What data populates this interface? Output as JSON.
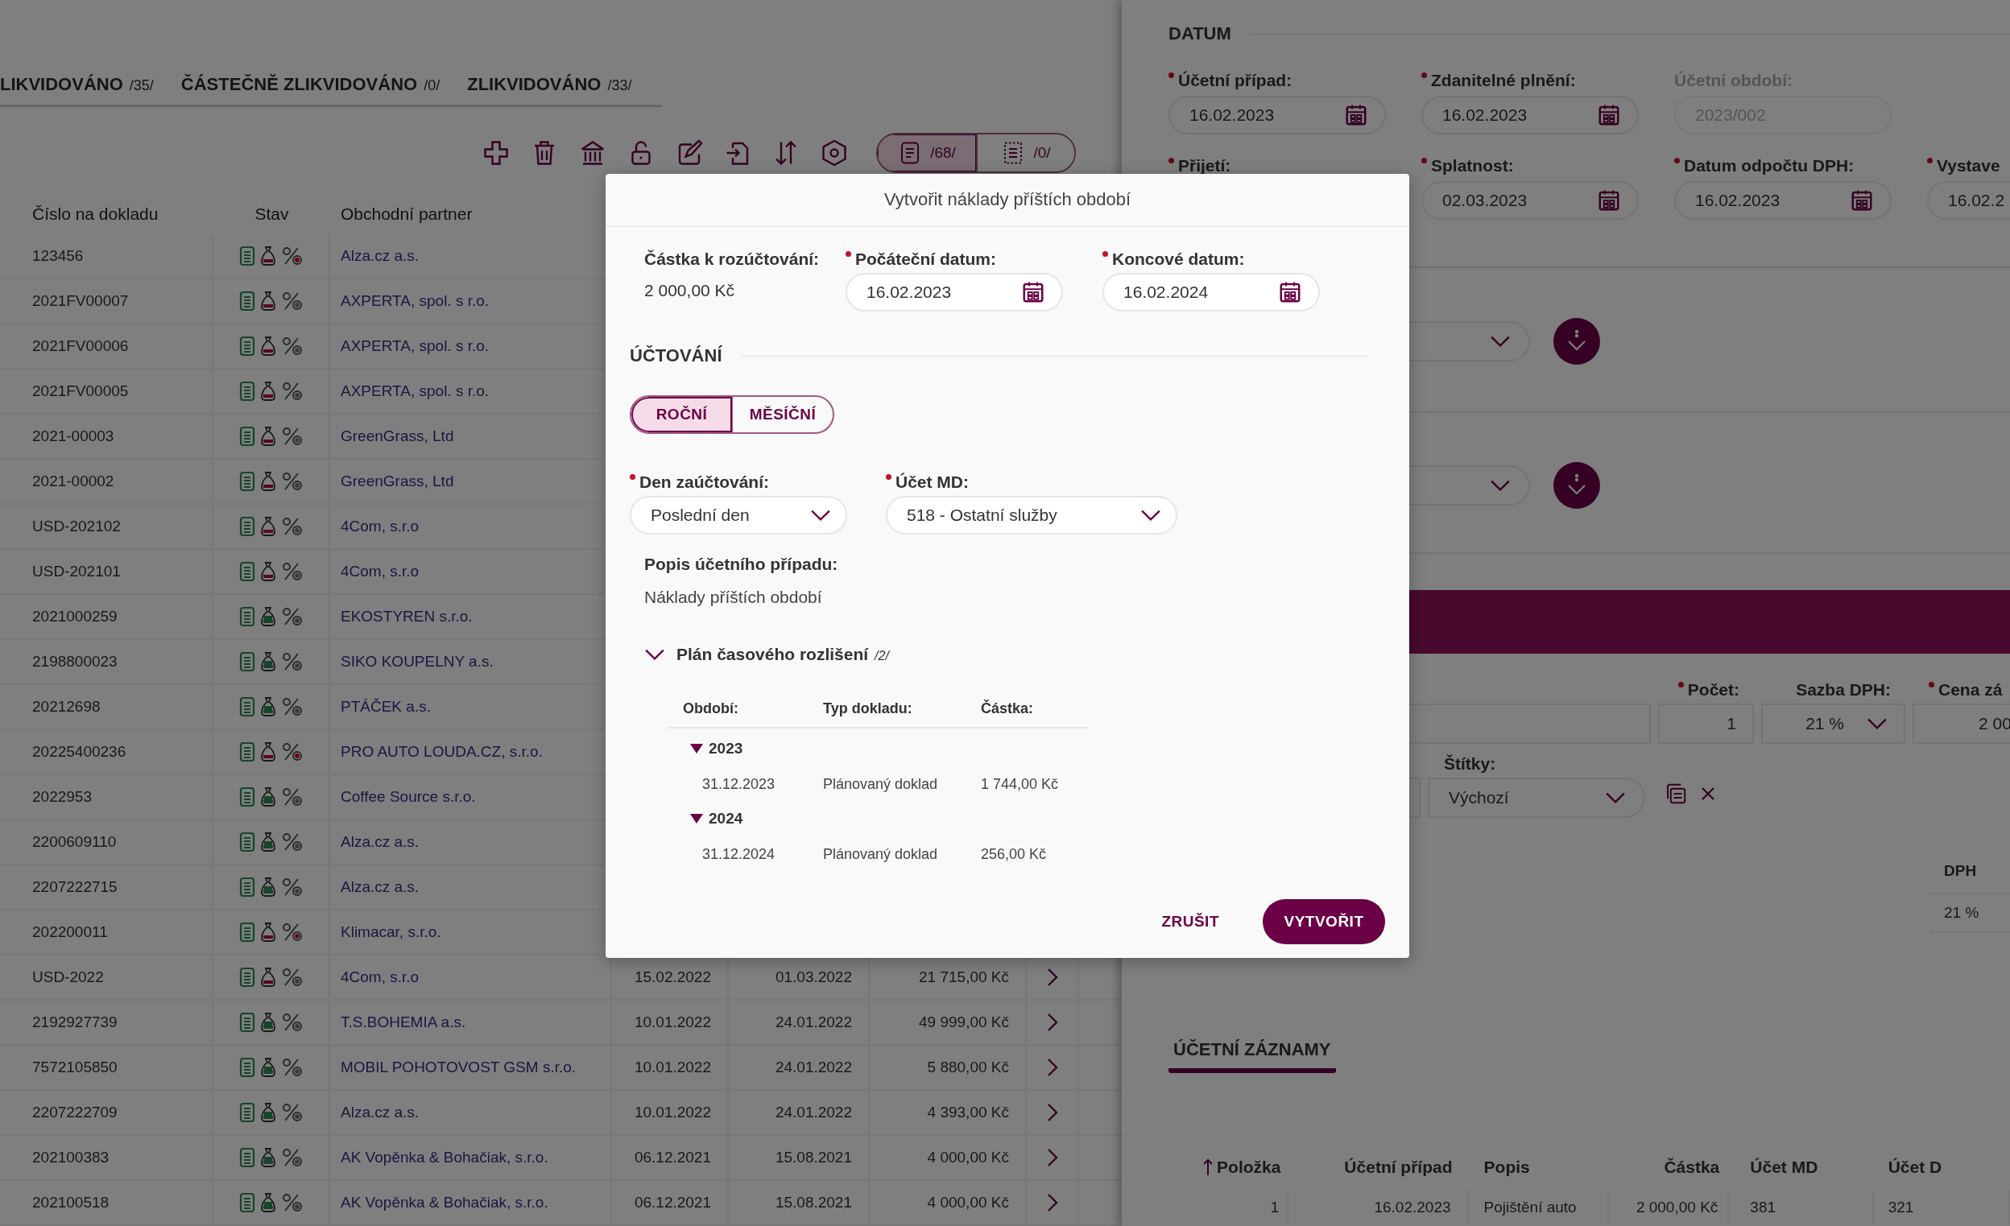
{
  "tabs": [
    {
      "label": "LIKVIDOVÁNO",
      "count": "/35/"
    },
    {
      "label": "ČÁSTEČNĚ ZLIKVIDOVÁNO",
      "count": "/0/"
    },
    {
      "label": "ZLIKVIDOVÁNO",
      "count": "/33/"
    }
  ],
  "view_toggle": [
    {
      "kind": "documents",
      "count": "/68/",
      "selected": true
    },
    {
      "kind": "drafts",
      "count": "/0/",
      "selected": false
    }
  ],
  "table": {
    "columns": [
      "Číslo na dokladu",
      "Stav",
      "Obchodní partner"
    ],
    "rows": [
      {
        "number": "123456",
        "settled": false,
        "vat_alert": true,
        "partner": "Alza.cz a.s."
      },
      {
        "number": "2021FV00007",
        "settled": false,
        "vat_alert": false,
        "partner": "AXPERTA, spol. s r.o."
      },
      {
        "number": "2021FV00006",
        "settled": false,
        "vat_alert": false,
        "partner": "AXPERTA, spol. s r.o."
      },
      {
        "number": "2021FV00005",
        "settled": false,
        "vat_alert": false,
        "partner": "AXPERTA, spol. s r.o."
      },
      {
        "number": "2021-00003",
        "settled": false,
        "vat_alert": false,
        "partner": "GreenGrass, Ltd"
      },
      {
        "number": "2021-00002",
        "settled": false,
        "vat_alert": false,
        "partner": "GreenGrass, Ltd"
      },
      {
        "number": "USD-202102",
        "settled": false,
        "vat_alert": false,
        "partner": "4Com, s.r.o"
      },
      {
        "number": "USD-202101",
        "settled": false,
        "vat_alert": false,
        "partner": "4Com, s.r.o"
      },
      {
        "number": "2021000259",
        "settled": true,
        "vat_alert": false,
        "partner": "EKOSTYREN s.r.o."
      },
      {
        "number": "2198800023",
        "settled": true,
        "vat_alert": false,
        "partner": "SIKO KOUPELNY a.s."
      },
      {
        "number": "20212698",
        "settled": true,
        "vat_alert": false,
        "partner": "PTÁČEK a.s."
      },
      {
        "number": "20225400236",
        "settled": false,
        "vat_alert": true,
        "partner": "PRO AUTO LOUDA.CZ, s.r.o."
      },
      {
        "number": "2022953",
        "settled": true,
        "vat_alert": false,
        "partner": "Coffee Source s.r.o."
      },
      {
        "number": "2200609110",
        "settled": true,
        "vat_alert": false,
        "partner": "Alza.cz a.s."
      },
      {
        "number": "2207222715",
        "settled": true,
        "vat_alert": false,
        "partner": "Alza.cz a.s."
      },
      {
        "number": "202200011",
        "settled": false,
        "vat_alert": true,
        "partner": "Klimacar, s.r.o."
      },
      {
        "number": "USD-2022",
        "settled": false,
        "vat_alert": false,
        "partner": "4Com, s.r.o",
        "issued": "15.02.2022",
        "due": "01.03.2022",
        "amount": "21 715,00 Kč"
      },
      {
        "number": "2192927739",
        "settled": true,
        "vat_alert": false,
        "partner": "T.S.BOHEMIA a.s.",
        "issued": "10.01.2022",
        "due": "24.01.2022",
        "amount": "49 999,00 Kč"
      },
      {
        "number": "7572105850",
        "settled": true,
        "vat_alert": false,
        "partner": "MOBIL POHOTOVOST GSM s.r.o.",
        "issued": "10.01.2022",
        "due": "24.01.2022",
        "amount": "5 880,00 Kč"
      },
      {
        "number": "2207222709",
        "settled": true,
        "vat_alert": false,
        "partner": "Alza.cz a.s.",
        "issued": "10.01.2022",
        "due": "24.01.2022",
        "amount": "4 393,00 Kč"
      },
      {
        "number": "202100383",
        "settled": true,
        "vat_alert": false,
        "partner": "AK Vopěnka & Bohačiak, s.r.o.",
        "issued": "06.12.2021",
        "due": "15.08.2021",
        "amount": "4 000,00 Kč"
      },
      {
        "number": "202100518",
        "settled": true,
        "vat_alert": false,
        "partner": "AK Vopěnka & Bohačiak, s.r.o.",
        "issued": "06.12.2021",
        "due": "15.08.2021",
        "amount": "4 000,00 Kč"
      }
    ]
  },
  "detail": {
    "date_section": "DATUM",
    "date_fields": [
      {
        "label": "Účetní případ:",
        "required": true,
        "disabled": false,
        "value": "16.02.2023"
      },
      {
        "label": "Zdanitelné plnění:",
        "required": true,
        "disabled": false,
        "value": "16.02.2023"
      },
      {
        "label": "Účetní období:",
        "required": false,
        "disabled": true,
        "value": "2023/002"
      },
      {
        "label": "Přijetí:",
        "required": true,
        "disabled": false
      },
      {
        "label": "Splatnost:",
        "required": true,
        "disabled": false,
        "value": "02.03.2023"
      },
      {
        "label": "Datum odpočtu DPH:",
        "required": true,
        "disabled": false,
        "value": "16.02.2023"
      },
      {
        "label": "Vystave",
        "required": true,
        "disabled": false,
        "value": "16.02.2"
      }
    ],
    "item_fields": [
      {
        "label": "Počet:",
        "required": true,
        "kind": "input",
        "value": "1"
      },
      {
        "label": "Sazba DPH:",
        "required": false,
        "kind": "select",
        "value": "21 %"
      },
      {
        "label": "Cena zá",
        "required": true,
        "kind": "input",
        "value": "2 00"
      }
    ],
    "tags": {
      "label": "Štítky:",
      "value": "Výchozí"
    },
    "vat_column": {
      "header": "DPH",
      "value": "21 %"
    },
    "records": {
      "tab": "ÚČETNÍ ZÁZNAMY",
      "columns": [
        {
          "label": "Položka",
          "sorted": true
        },
        {
          "label": "Účetní případ",
          "sorted": false
        },
        {
          "label": "Popis",
          "sorted": false
        },
        {
          "label": "Částka",
          "sorted": false
        },
        {
          "label": "Účet MD",
          "sorted": false
        },
        {
          "label": "Účet D",
          "sorted": false
        }
      ],
      "rows": [
        [
          "1",
          "16.02.2023",
          "Pojištění auto",
          "2 000,00 Kč",
          "381",
          "321"
        ]
      ]
    }
  },
  "dialog": {
    "title": "Vytvořit náklady příštích období",
    "amount": {
      "label": "Částka k rozúčtování:",
      "value": "2 000,00 Kč"
    },
    "dates": [
      {
        "label": "Počáteční datum:",
        "required": true,
        "value": "16.02.2023"
      },
      {
        "label": "Koncové datum:",
        "required": true,
        "value": "16.02.2024"
      }
    ],
    "section": "ÚČTOVÁNÍ",
    "period_toggle": [
      {
        "label": "ROČNÍ",
        "selected": true
      },
      {
        "label": "MĚSÍČNÍ",
        "selected": false
      }
    ],
    "selects": [
      {
        "label": "Den zaúčtování:",
        "required": true,
        "value": "Poslední den"
      },
      {
        "label": "Účet MD:",
        "required": true,
        "value": "518 - Ostatní služby"
      }
    ],
    "description": {
      "label": "Popis účetního případu:",
      "value": "Náklady příštích období"
    },
    "plan": {
      "title": "Plán časového rozlišení",
      "count": "/2/",
      "expanded": true,
      "columns": [
        "Období:",
        "Typ dokladu:",
        "Částka:"
      ],
      "groups": [
        {
          "year": "2023",
          "expanded": true,
          "children": [
            {
              "date": "31.12.2023",
              "type": "Plánovaný doklad",
              "amount": "1 744,00 Kč"
            }
          ]
        },
        {
          "year": "2024",
          "expanded": true,
          "children": [
            {
              "date": "31.12.2024",
              "type": "Plánovaný doklad",
              "amount": "256,00 Kč"
            }
          ]
        }
      ]
    },
    "buttons": [
      {
        "label": "ZRUŠIT",
        "kind": "text"
      },
      {
        "label": "VYTVOŘIT",
        "kind": "primary"
      }
    ]
  }
}
